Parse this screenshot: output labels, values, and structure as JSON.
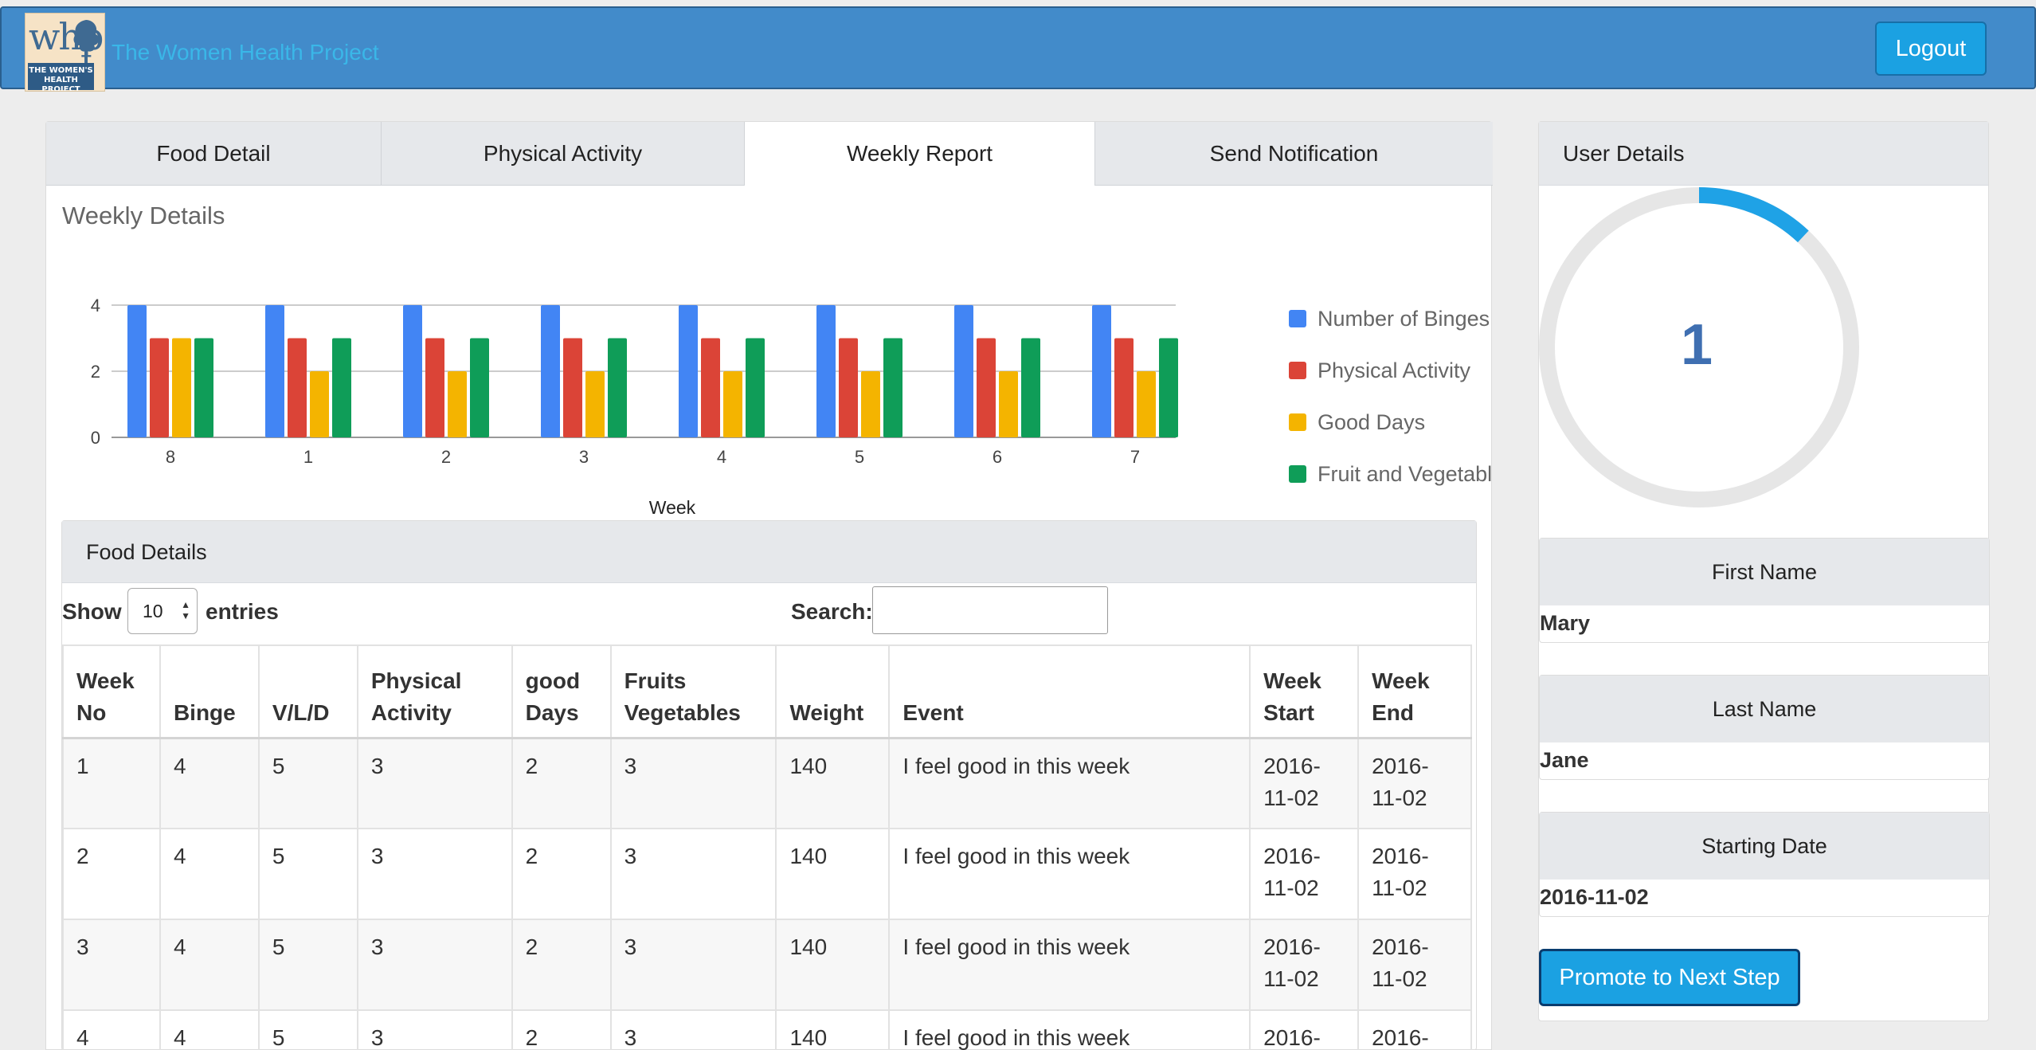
{
  "navbar": {
    "logo_letters": "whp",
    "logo_text": "THE WOMEN'S HEALTH PROJECT",
    "title": "The Women Health Project",
    "logout_label": "Logout"
  },
  "tabs": [
    {
      "label": "Food Detail"
    },
    {
      "label": "Physical Activity"
    },
    {
      "label": "Weekly Report"
    },
    {
      "label": "Send Notification"
    }
  ],
  "weekly": {
    "title": "Weekly Details"
  },
  "chart_data": {
    "type": "bar",
    "title": "",
    "xlabel": "Week",
    "ylabel": "",
    "ylim": [
      0,
      4
    ],
    "yticks": [
      0,
      2,
      4
    ],
    "grid": true,
    "legend_position": "right",
    "categories": [
      "8",
      "1",
      "2",
      "3",
      "4",
      "5",
      "6",
      "7"
    ],
    "series": [
      {
        "name": "Number of Binges",
        "color": "#4285f4",
        "values": [
          4,
          4,
          4,
          4,
          4,
          4,
          4,
          4
        ]
      },
      {
        "name": "Physical Activity",
        "color": "#db4437",
        "values": [
          3,
          3,
          3,
          3,
          3,
          3,
          3,
          3
        ]
      },
      {
        "name": "Good Days",
        "color": "#f4b400",
        "values": [
          3,
          2,
          2,
          2,
          2,
          2,
          2,
          2
        ]
      },
      {
        "name": "Fruit and Vegetables",
        "color": "#0f9d58",
        "values": [
          3,
          3,
          3,
          3,
          3,
          3,
          3,
          3
        ]
      }
    ]
  },
  "food_details": {
    "heading": "Food Details",
    "show_label": "Show",
    "entries_value": "10",
    "entries_label": "entries",
    "search_label": "Search:",
    "search_value": "",
    "columns": [
      "Week No",
      "Binge",
      "V/L/D",
      "Physical Activity",
      "good Days",
      "Fruits Vegetables",
      "Weight",
      "Event",
      "Week Start",
      "Week End"
    ],
    "rows": [
      [
        "1",
        "4",
        "5",
        "3",
        "2",
        "3",
        "140",
        "I feel good in this week",
        "2016-11-02",
        "2016-11-02"
      ],
      [
        "2",
        "4",
        "5",
        "3",
        "2",
        "3",
        "140",
        "I feel good in this week",
        "2016-11-02",
        "2016-11-02"
      ],
      [
        "3",
        "4",
        "5",
        "3",
        "2",
        "3",
        "140",
        "I feel good in this week",
        "2016-11-02",
        "2016-11-02"
      ],
      [
        "4",
        "4",
        "5",
        "3",
        "2",
        "3",
        "140",
        "I feel good in this week",
        "2016-",
        "2016-"
      ]
    ]
  },
  "user_details": {
    "heading": "User Details",
    "progress_value": "1",
    "progress_fraction": 0.12,
    "progress_color": "#1fa2e6",
    "track_color": "#e6e6e6",
    "first_name_label": "First Name",
    "first_name": "Mary",
    "last_name_label": "Last Name",
    "last_name": "Jane",
    "starting_date_label": "Starting Date",
    "starting_date": "2016-11-02",
    "promote_label": "Promote to Next Step"
  }
}
